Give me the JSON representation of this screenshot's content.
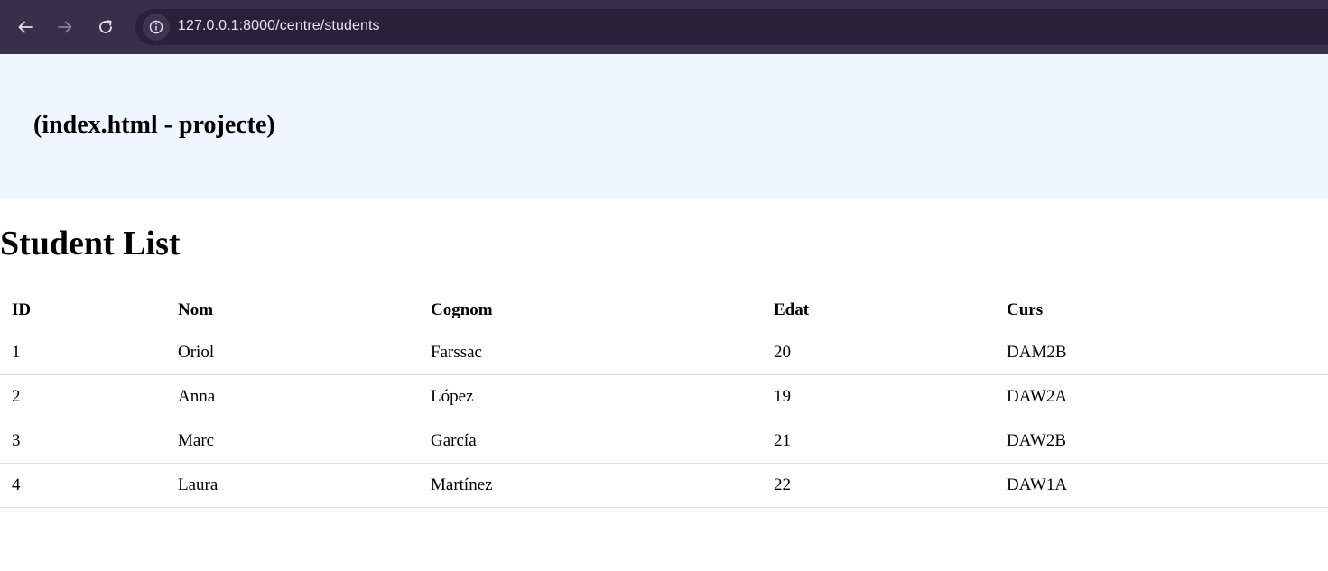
{
  "browser": {
    "url": "127.0.0.1:8000/centre/students",
    "colors": {
      "chrome": "#3a2f4a",
      "address_bar": "#29203a",
      "url_text": "#e8e3ee"
    }
  },
  "header": {
    "text": "(index.html - projecte)",
    "background": "#eef6ff"
  },
  "main": {
    "title": "Student List",
    "table": {
      "columns": [
        "ID",
        "Nom",
        "Cognom",
        "Edat",
        "Curs"
      ],
      "rows": [
        [
          "1",
          "Oriol",
          "Farssac",
          "20",
          "DAM2B"
        ],
        [
          "2",
          "Anna",
          "López",
          "19",
          "DAW2A"
        ],
        [
          "3",
          "Marc",
          "García",
          "21",
          "DAW2B"
        ],
        [
          "4",
          "Laura",
          "Martínez",
          "22",
          "DAW1A"
        ]
      ]
    }
  },
  "icons": {
    "back": "arrow-left-icon",
    "forward": "arrow-right-icon",
    "reload": "reload-icon",
    "site_info": "info-icon"
  }
}
